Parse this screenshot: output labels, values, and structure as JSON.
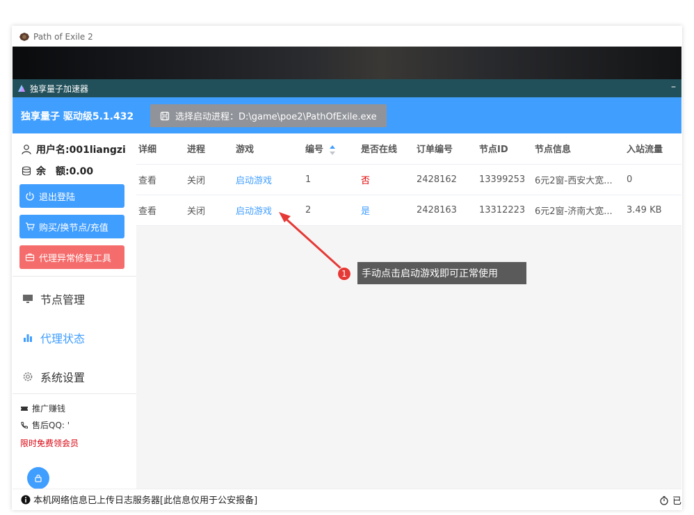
{
  "game_window": {
    "title": "Path of Exile 2"
  },
  "app": {
    "title": "独享量子加速器",
    "minimize": "–",
    "brand": "独享量子 驱动级5.1.432",
    "process_button": "选择启动进程：D:\\game\\poe2\\PathOfExile.exe"
  },
  "sidebar": {
    "username": "用户名:001liangzi",
    "balance": "余　额:0.00",
    "buttons": {
      "logout": "退出登陆",
      "buy": "购买/换节点/充值",
      "repair": "代理异常修复工具"
    },
    "nav": [
      {
        "label": "节点管理",
        "icon": "monitor-icon",
        "active": false
      },
      {
        "label": "代理状态",
        "icon": "bar-chart-icon",
        "active": true
      },
      {
        "label": "系统设置",
        "icon": "gear-icon",
        "active": false
      }
    ],
    "promote": "推广赚钱",
    "support": "售后QQ: '",
    "promo": "限时免费领会员"
  },
  "table": {
    "headers": [
      "详细",
      "进程",
      "游戏",
      "编号",
      "是否在线",
      "订单编号",
      "节点ID",
      "节点信息",
      "入站流量"
    ],
    "rows": [
      {
        "detail": "查看",
        "process": "关闭",
        "game": "启动游戏",
        "no": "1",
        "online": "否",
        "order": "2428162",
        "node_id": "13399253",
        "node_info": "6元2窗-西安大宽...",
        "traffic": "0"
      },
      {
        "detail": "查看",
        "process": "关闭",
        "game": "启动游戏",
        "no": "2",
        "online": "是",
        "order": "2428163",
        "node_id": "13312223",
        "node_info": "6元2窗-济南大宽...",
        "traffic": "3.49 KB"
      }
    ]
  },
  "annotation": {
    "number": "1",
    "text": "手动点击启动游戏即可正常使用"
  },
  "statusbar": {
    "text": "本机网络信息已上传日志服务器[此信息仅用于公安报备]",
    "right": "已"
  },
  "colors": {
    "primary": "#409eff",
    "danger": "#f56c6c",
    "titlebar": "#22505a",
    "offline": "#e00000"
  }
}
